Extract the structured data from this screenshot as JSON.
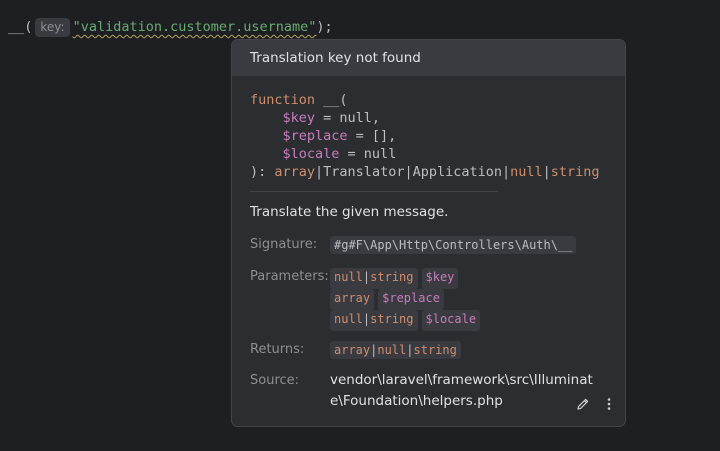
{
  "editor": {
    "fn_call": "__(",
    "param_hint": "key:",
    "string_arg": "\"validation.customer.username\"",
    "suffix": ");"
  },
  "popup": {
    "header": "Translation key not found",
    "signature": {
      "line1_kw": "function",
      "line1_name": " __(",
      "params": [
        {
          "name": "$key",
          "rest": " = null,"
        },
        {
          "name": "$replace",
          "rest": " = [],"
        },
        {
          "name": "$locale",
          "rest": " = null"
        }
      ],
      "close": "): ",
      "return_parts": [
        {
          "text": "array",
          "kind": "kw"
        },
        {
          "text": "|",
          "kind": "plain"
        },
        {
          "text": "Translator",
          "kind": "plain"
        },
        {
          "text": "|",
          "kind": "plain"
        },
        {
          "text": "Application",
          "kind": "plain"
        },
        {
          "text": "|",
          "kind": "plain"
        },
        {
          "text": "null",
          "kind": "kw"
        },
        {
          "text": "|",
          "kind": "plain"
        },
        {
          "text": "string",
          "kind": "kw"
        }
      ]
    },
    "description": "Translate the given message.",
    "signature_label": "Signature:",
    "signature_value": "#g#F\\App\\Http\\Controllers\\Auth\\__",
    "parameters_label": "Parameters:",
    "parameters": [
      {
        "type_parts": [
          "null",
          "|",
          "string"
        ],
        "name": "$key"
      },
      {
        "type_parts": [
          "array"
        ],
        "name": "$replace"
      },
      {
        "type_parts": [
          "null",
          "|",
          "string"
        ],
        "name": "$locale"
      }
    ],
    "returns_label": "Returns:",
    "returns_parts": [
      "array",
      "|",
      "null",
      "|",
      "string"
    ],
    "source_label": "Source:",
    "source_value": "vendor\\laravel\\framework\\src\\Illuminate\\Foundation\\helpers.php",
    "icons": {
      "edit": "pencil-icon",
      "more": "more-vertical-icon"
    }
  },
  "colors": {
    "background": "#1e1f22",
    "popup_bg": "#2b2d30",
    "keyword": "#cf8e6d",
    "variable": "#c77dbb",
    "string": "#6aab73"
  }
}
